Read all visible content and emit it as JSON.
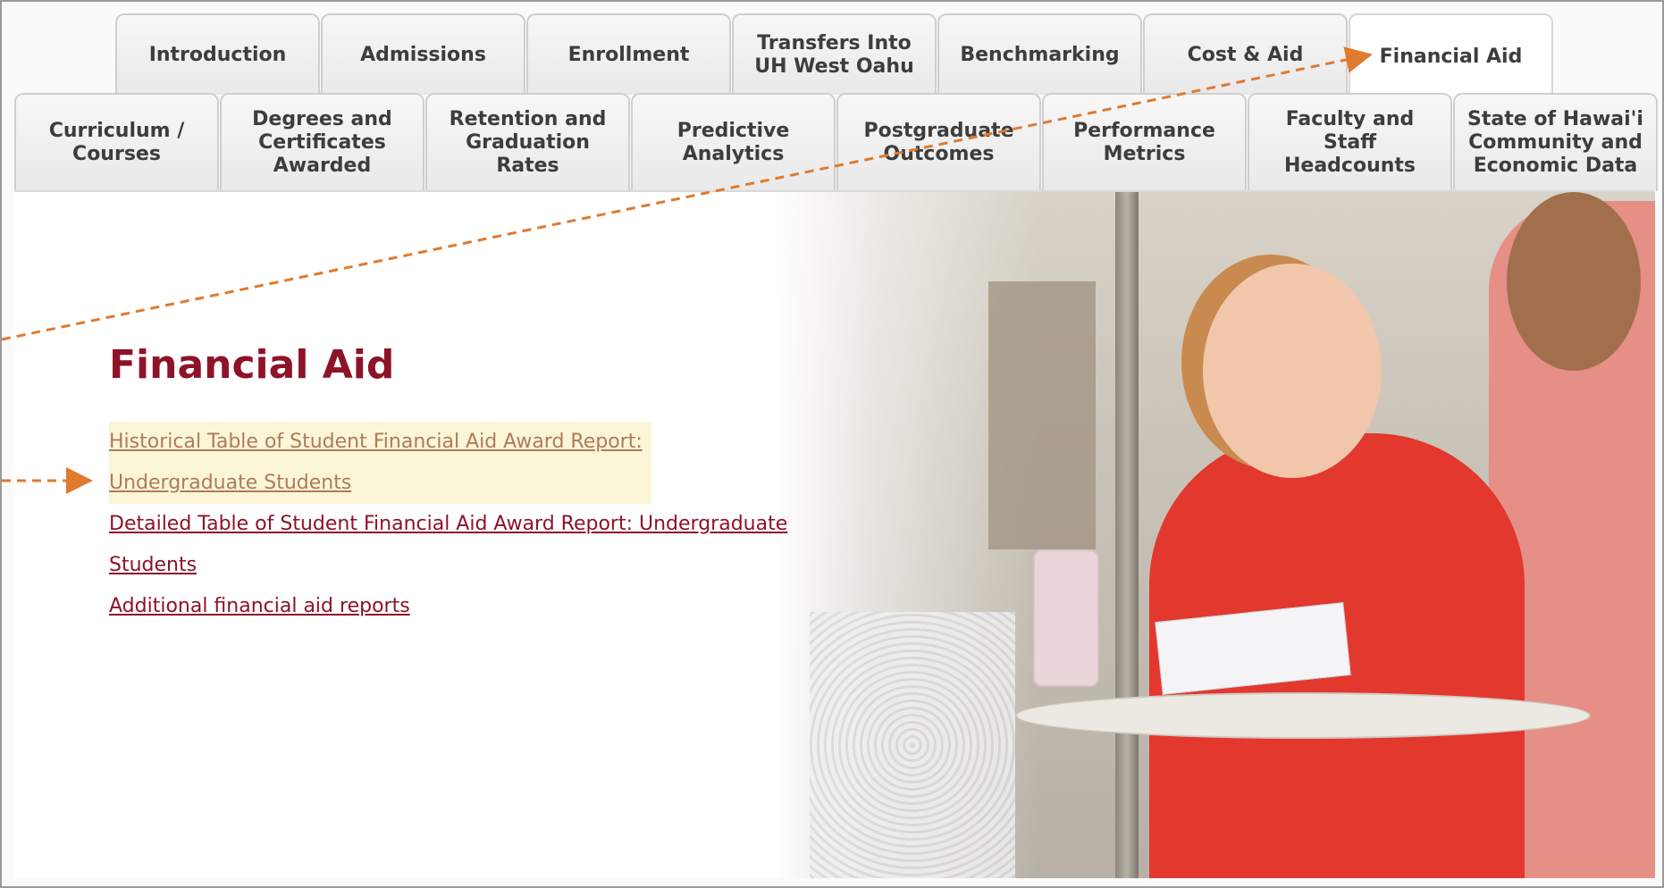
{
  "tabs_top": [
    {
      "id": "introduction",
      "label": "Introduction"
    },
    {
      "id": "admissions",
      "label": "Admissions"
    },
    {
      "id": "enrollment",
      "label": "Enrollment"
    },
    {
      "id": "transfers",
      "label": "Transfers Into\nUH West Oahu"
    },
    {
      "id": "benchmarking",
      "label": "Benchmarking"
    },
    {
      "id": "cost-aid",
      "label": "Cost & Aid"
    },
    {
      "id": "financial-aid",
      "label": "Financial Aid",
      "active": true
    }
  ],
  "tabs_bottom": [
    {
      "id": "curriculum",
      "label": "Curriculum /\nCourses"
    },
    {
      "id": "degrees",
      "label": "Degrees and\nCertificates\nAwarded"
    },
    {
      "id": "retention",
      "label": "Retention and\nGraduation\nRates"
    },
    {
      "id": "predictive",
      "label": "Predictive\nAnalytics"
    },
    {
      "id": "postgraduate",
      "label": "Postgraduate\nOutcomes"
    },
    {
      "id": "performance",
      "label": "Performance\nMetrics"
    },
    {
      "id": "faculty",
      "label": "Faculty and\nStaff\nHeadcounts"
    },
    {
      "id": "state",
      "label": "State of Hawai'i\nCommunity and\nEconomic Data"
    }
  ],
  "main": {
    "title": "Financial Aid",
    "links": [
      "Historical Table of Student Financial Aid Award Report:",
      "Undergraduate Students",
      "Detailed Table of Student Financial Aid Award Report: Undergraduate",
      "Students",
      "Additional financial aid reports"
    ]
  },
  "colors": {
    "accent": "#8e1228",
    "annotation_arrow": "#e07a2e",
    "highlight": "#fbf6d8"
  }
}
